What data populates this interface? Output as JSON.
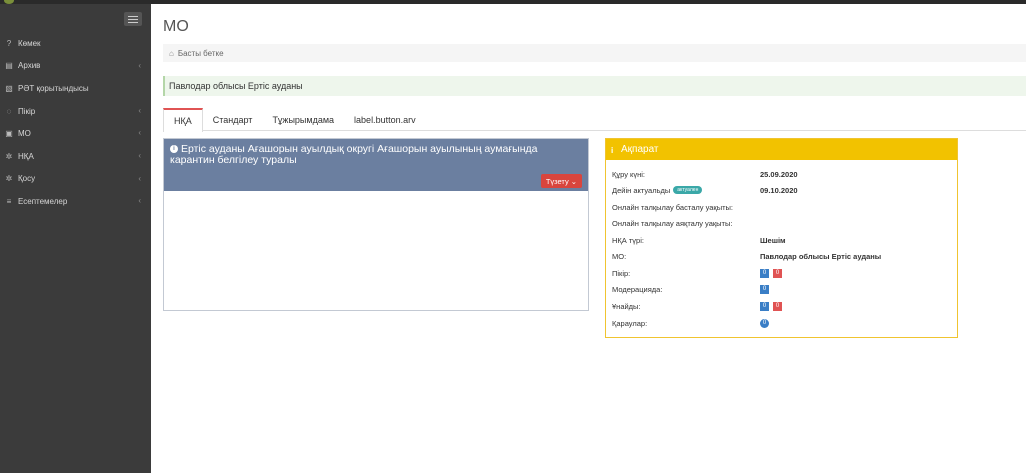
{
  "sidebar": {
    "items": [
      {
        "icon": "question-icon",
        "glyph": "?",
        "label": "Көмек",
        "has_children": false
      },
      {
        "icon": "archive-icon",
        "glyph": "▤",
        "label": "Архив",
        "has_children": true
      },
      {
        "icon": "file-icon",
        "glyph": "▧",
        "label": "РӘТ қорытындысы",
        "has_children": false
      },
      {
        "icon": "comment-icon",
        "glyph": "◌",
        "label": "Пікір",
        "has_children": true
      },
      {
        "icon": "briefcase-icon",
        "glyph": "▣",
        "label": "МО",
        "has_children": true
      },
      {
        "icon": "gear-icon",
        "glyph": "✲",
        "label": "НҚА",
        "has_children": true
      },
      {
        "icon": "gear-icon",
        "glyph": "✲",
        "label": "Қосу",
        "has_children": true
      },
      {
        "icon": "list-icon",
        "glyph": "≡",
        "label": "Есептемелер",
        "has_children": true
      }
    ]
  },
  "header": {
    "title": "МО",
    "breadcrumb": "Басты бетке"
  },
  "region": "Павлодар облысы Ертіс ауданы",
  "tabs": [
    {
      "label": "НҚА",
      "active": true
    },
    {
      "label": "Стандарт",
      "active": false
    },
    {
      "label": "Тұжырымдама",
      "active": false
    },
    {
      "label": "label.button.arv",
      "active": false
    }
  ],
  "document": {
    "title": "Ертіс ауданы Ағашорын ауылдық округі Ағашорын ауылының аумағында карантин белгілеу туралы",
    "edit_button": "Түзету"
  },
  "info": {
    "title": "Ақпарат",
    "created_label": "Құру күні:",
    "created_value": "25.09.2020",
    "valid_label": "Дейін актуальды",
    "valid_badge": "актуален",
    "valid_value": "09.10.2020",
    "online_start_label": "Онлайн талқылау басталу уақыты:",
    "online_end_label": "Онлайн талқылау аяқталу уақыты:",
    "type_label": "НҚА түрі:",
    "type_value": "Шешім",
    "mo_label": "МО:",
    "mo_value": "Павлодар облысы Ертіс ауданы",
    "comments_label": "Пікір:",
    "comments_a": "0",
    "comments_b": "0",
    "moderation_label": "Модерацияда:",
    "moderation_value": "0",
    "likes_label": "Ұнайды:",
    "likes_a": "0",
    "likes_b": "0",
    "views_label": "Қараулар:",
    "views_value": "0"
  }
}
